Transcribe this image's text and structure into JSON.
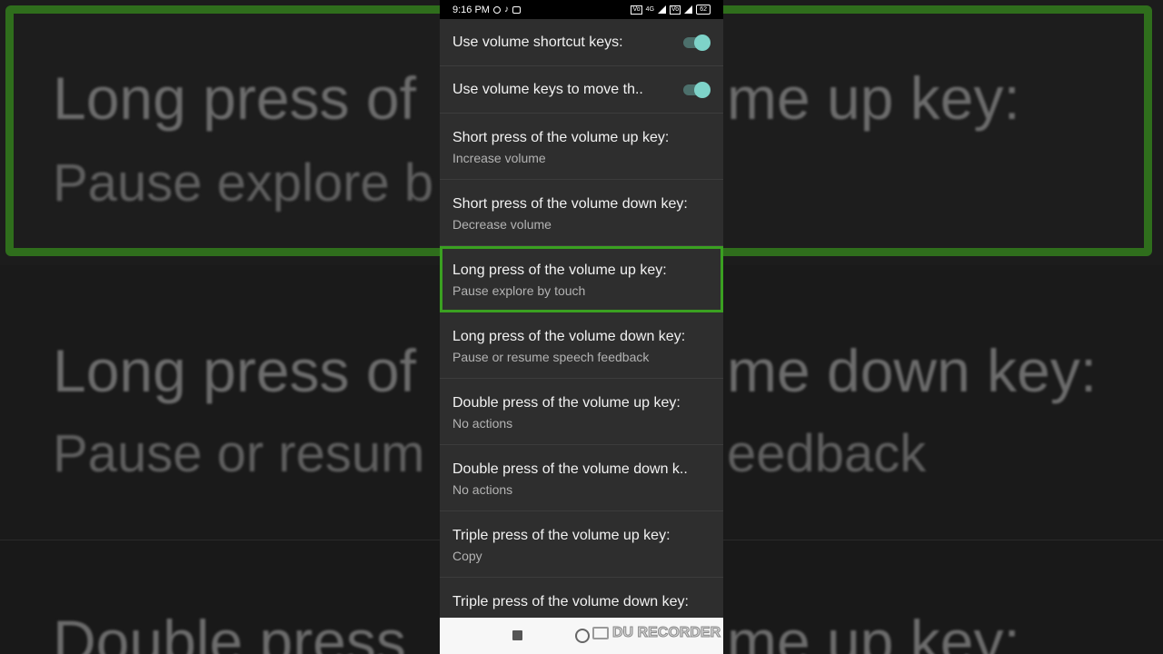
{
  "status_bar": {
    "time": "9:16 PM",
    "battery": "62",
    "network_tag": "4G"
  },
  "background": {
    "line1_title": "Long press of",
    "line1_title_right": "me up key:",
    "line1_sub": "Pause explore b",
    "line2_title": "Long press of",
    "line2_title_right": "me down key:",
    "line2_sub": "Pause or resum",
    "line2_sub_right": "eedback",
    "line3_title": "Double press",
    "line3_title_right": "me up key:"
  },
  "settings": {
    "toggles": [
      {
        "label": "Use volume shortcut keys:",
        "on": true
      },
      {
        "label": "Use volume keys to move th..",
        "on": true
      }
    ],
    "items": [
      {
        "title": "Short press of the volume up key:",
        "value": "Increase volume"
      },
      {
        "title": "Short press of the volume down key:",
        "value": "Decrease volume"
      },
      {
        "title": "Long press of the volume up key:",
        "value": "Pause explore by touch",
        "focused": true
      },
      {
        "title": "Long press of the volume down key:",
        "value": "Pause or resume speech feedback"
      },
      {
        "title": "Double press of the volume up key:",
        "value": "No actions"
      },
      {
        "title": "Double press of the volume down k..",
        "value": "No actions"
      },
      {
        "title": "Triple press of the volume up key:",
        "value": "Copy"
      },
      {
        "title": "Triple press of the volume down key:",
        "value": ""
      }
    ]
  },
  "watermark": "DU RECORDER",
  "colors": {
    "focus": "#3aa021",
    "switch_knob": "#7ed3c9",
    "row_bg": "#2e2e2e"
  }
}
